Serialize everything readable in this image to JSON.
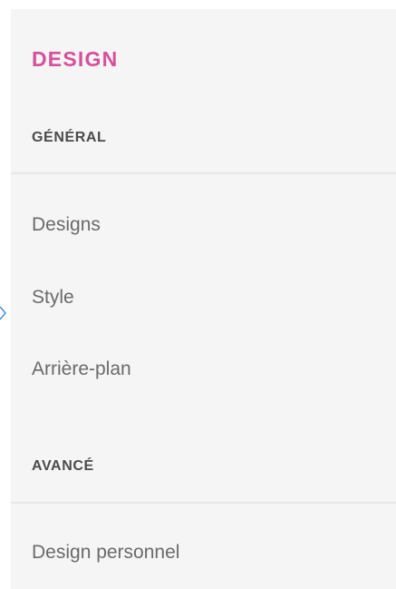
{
  "panel": {
    "title": "DESIGN",
    "sections": [
      {
        "header": "GÉNÉRAL",
        "items": [
          "Designs",
          "Style",
          "Arrière-plan"
        ]
      },
      {
        "header": "AVANCÉ",
        "items": [
          "Design personnel"
        ]
      }
    ]
  },
  "colors": {
    "title": "#d6509a",
    "marker": "#3a8ee6"
  }
}
